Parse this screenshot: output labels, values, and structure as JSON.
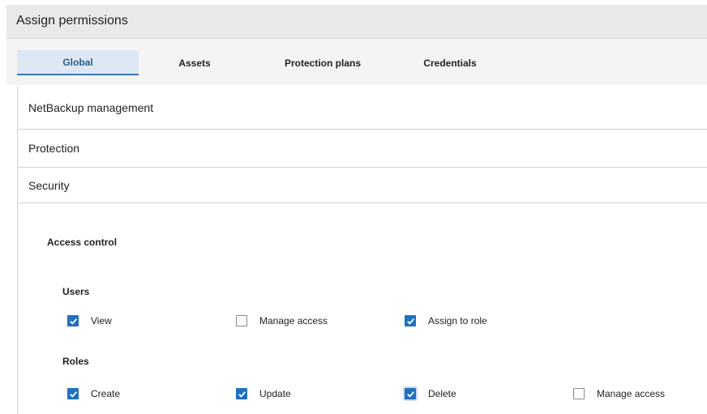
{
  "header": {
    "title": "Assign permissions"
  },
  "tabs": [
    {
      "label": "Global",
      "active": true
    },
    {
      "label": "Assets",
      "active": false
    },
    {
      "label": "Protection plans",
      "active": false
    },
    {
      "label": "Credentials",
      "active": false
    }
  ],
  "accordions": [
    {
      "label": "NetBackup management"
    },
    {
      "label": "Protection"
    },
    {
      "label": "Security"
    }
  ],
  "security": {
    "heading": "Access control",
    "users": {
      "heading": "Users",
      "items": [
        {
          "label": "View",
          "checked": true
        },
        {
          "label": "Manage access",
          "checked": false
        },
        {
          "label": "Assign to role",
          "checked": true
        }
      ]
    },
    "roles": {
      "heading": "Roles",
      "items": [
        {
          "label": "Create",
          "checked": true
        },
        {
          "label": "Update",
          "checked": true
        },
        {
          "label": "Delete",
          "checked": true
        },
        {
          "label": "Manage access",
          "checked": false
        }
      ]
    }
  },
  "colors": {
    "accent": "#1f70c1",
    "tab_active_bg": "#dde8f4",
    "header_bg": "#e9e9e9"
  }
}
